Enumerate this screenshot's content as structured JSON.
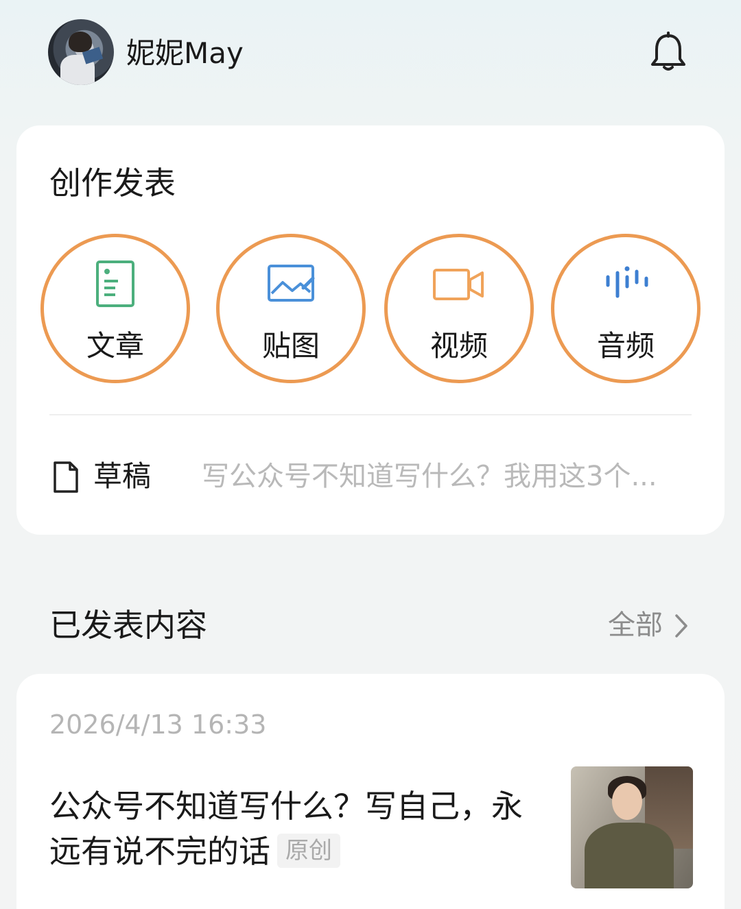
{
  "header": {
    "username": "妮妮May"
  },
  "create": {
    "title": "创作发表",
    "actions": [
      {
        "label": "文章",
        "icon": "article-icon",
        "color": "#4caf7d"
      },
      {
        "label": "贴图",
        "icon": "image-icon",
        "color": "#4a90d9"
      },
      {
        "label": "视频",
        "icon": "video-icon",
        "color": "#f0a35a"
      },
      {
        "label": "音频",
        "icon": "audio-icon",
        "color": "#3d7fd1"
      }
    ],
    "highlight_color": "#ec9a52",
    "draft": {
      "label": "草稿",
      "preview": "写公众号不知道写什么？我用这3个..."
    }
  },
  "published": {
    "title": "已发表内容",
    "view_all": "全部",
    "posts": [
      {
        "time": "2026/4/13 16:33",
        "title": "公众号不知道写什么？写自己，永远有说不完的话",
        "badge": "原创"
      }
    ]
  }
}
